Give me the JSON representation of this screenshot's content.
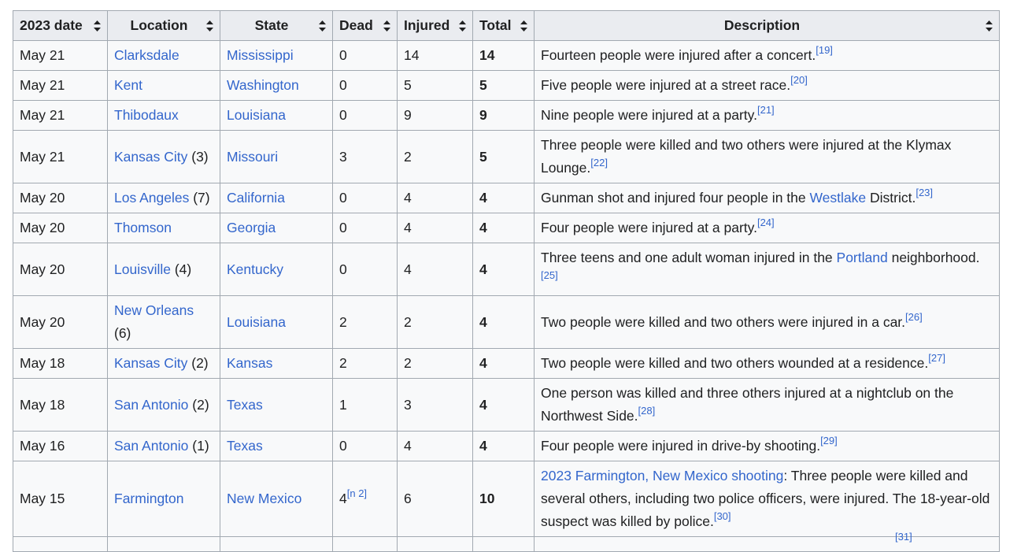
{
  "headers": [
    "2023 date",
    "Location",
    "State",
    "Dead",
    "Injured",
    "Total",
    "Description"
  ],
  "rows": [
    {
      "date": "May 21",
      "location": "Clarksdale",
      "count": "",
      "state": "Mississippi",
      "dead": "0",
      "dead_note": "",
      "injured": "14",
      "total": "14",
      "desc_link": "",
      "desc": "Fourteen people were injured after a concert.",
      "desc_mid_link": "",
      "desc_tail": "",
      "ref": "[19]"
    },
    {
      "date": "May 21",
      "location": "Kent",
      "count": "",
      "state": "Washington",
      "dead": "0",
      "dead_note": "",
      "injured": "5",
      "total": "5",
      "desc_link": "",
      "desc": "Five people were injured at a street race.",
      "desc_mid_link": "",
      "desc_tail": "",
      "ref": "[20]"
    },
    {
      "date": "May 21",
      "location": "Thibodaux",
      "count": "",
      "state": "Louisiana",
      "dead": "0",
      "dead_note": "",
      "injured": "9",
      "total": "9",
      "desc_link": "",
      "desc": "Nine people were injured at a party.",
      "desc_mid_link": "",
      "desc_tail": "",
      "ref": "[21]"
    },
    {
      "date": "May 21",
      "location": "Kansas City",
      "count": " (3)",
      "state": "Missouri",
      "dead": "3",
      "dead_note": "",
      "injured": "2",
      "total": "5",
      "desc_link": "",
      "desc": "Three people were killed and two others were injured at the Klymax Lounge.",
      "desc_mid_link": "",
      "desc_tail": "",
      "ref": "[22]"
    },
    {
      "date": "May 20",
      "location": "Los Angeles",
      "count": " (7)",
      "state": "California",
      "dead": "0",
      "dead_note": "",
      "injured": "4",
      "total": "4",
      "desc_link": "",
      "desc": "Gunman shot and injured four people in the ",
      "desc_mid_link": "Westlake",
      "desc_tail": " District.",
      "ref": "[23]"
    },
    {
      "date": "May 20",
      "location": "Thomson",
      "count": "",
      "state": "Georgia",
      "dead": "0",
      "dead_note": "",
      "injured": "4",
      "total": "4",
      "desc_link": "",
      "desc": "Four people were injured at a party.",
      "desc_mid_link": "",
      "desc_tail": "",
      "ref": "[24]"
    },
    {
      "date": "May 20",
      "location": "Louisville",
      "count": " (4)",
      "state": "Kentucky",
      "dead": "0",
      "dead_note": "",
      "injured": "4",
      "total": "4",
      "desc_link": "",
      "desc": "Three teens and one adult woman injured in the ",
      "desc_mid_link": "Portland",
      "desc_tail": " neighborhood.",
      "ref": "[25]"
    },
    {
      "date": "May 20",
      "location": "New Orleans",
      "count": " (6)",
      "state": "Louisiana",
      "dead": "2",
      "dead_note": "",
      "injured": "2",
      "total": "4",
      "desc_link": "",
      "desc": "Two people were killed and two others were injured in a car.",
      "desc_mid_link": "",
      "desc_tail": "",
      "ref": "[26]"
    },
    {
      "date": "May 18",
      "location": "Kansas City",
      "count": " (2)",
      "state": "Kansas",
      "dead": "2",
      "dead_note": "",
      "injured": "2",
      "total": "4",
      "desc_link": "",
      "desc": "Two people were killed and two others wounded at a residence.",
      "desc_mid_link": "",
      "desc_tail": "",
      "ref": "[27]"
    },
    {
      "date": "May 18",
      "location": "San Antonio",
      "count": " (2)",
      "state": "Texas",
      "dead": "1",
      "dead_note": "",
      "injured": "3",
      "total": "4",
      "desc_link": "",
      "desc": "One person was killed and three others injured at a nightclub on the Northwest Side.",
      "desc_mid_link": "",
      "desc_tail": "",
      "ref": "[28]"
    },
    {
      "date": "May 16",
      "location": "San Antonio",
      "count": " (1)",
      "state": "Texas",
      "dead": "0",
      "dead_note": "",
      "injured": "4",
      "total": "4",
      "desc_link": "",
      "desc": "Four people were injured in drive-by shooting.",
      "desc_mid_link": "",
      "desc_tail": "",
      "ref": "[29]"
    },
    {
      "date": "May 15",
      "location": "Farmington",
      "count": "",
      "state": "New Mexico",
      "dead": "4",
      "dead_note": "[n 2]",
      "injured": "6",
      "total": "10",
      "desc_link": "2023 Farmington, New Mexico shooting",
      "desc": ": Three people were killed and several others, including two police officers, were injured. The 18-year-old suspect was killed by police.",
      "desc_mid_link": "",
      "desc_tail": "",
      "ref": "[30]"
    }
  ],
  "partial_ref": "[31]"
}
